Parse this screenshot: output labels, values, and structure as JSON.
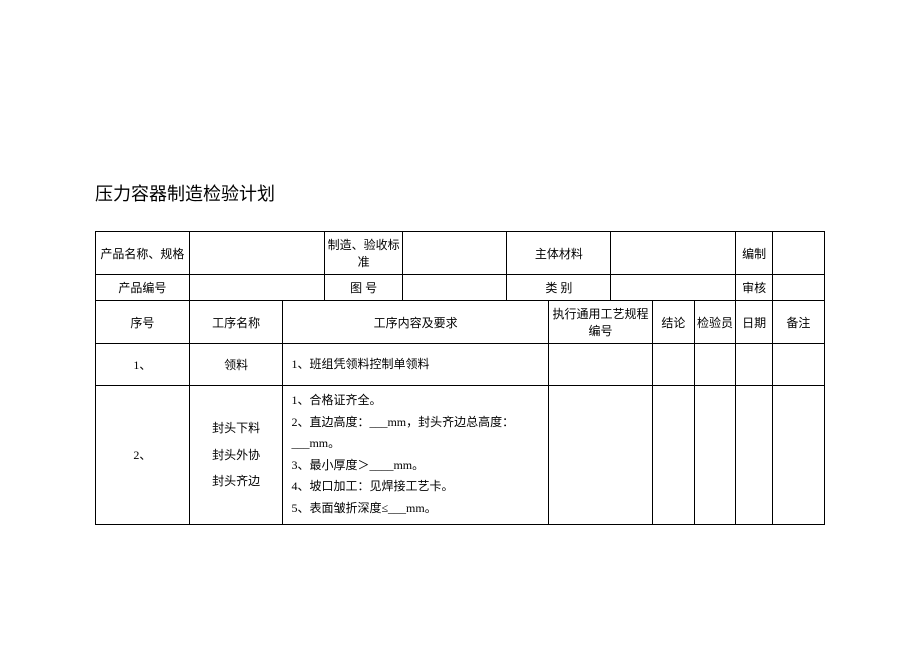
{
  "title": "压力容器制造检验计划",
  "header_labels": {
    "product_name_spec": "产品名称、规格",
    "mfg_accept_std": "制造、验收标准",
    "main_material": "主体材料",
    "prepared_by": "编制",
    "product_no": "产品编号",
    "drawing_no": "图 号",
    "category": "类 别",
    "reviewed_by": "审核"
  },
  "col_headers": {
    "seq": "序号",
    "process_name": "工序名称",
    "process_content": "工序内容及要求",
    "general_proc_no": "执行通用工艺规程编号",
    "conclusion": "结论",
    "inspector": "检验员",
    "date": "日期",
    "remark": "备注"
  },
  "rows": [
    {
      "seq": "1、",
      "process_name": "领料",
      "content": "1、班组凭领料控制单领料"
    },
    {
      "seq": "2、",
      "process_name": "封头下料\n封头外协\n封头齐边",
      "content": "1、合格证齐全。\n2、直边高度：___mm，封头齐边总高度：___mm。\n3、最小厚度＞____mm。\n4、坡口加工：见焊接工艺卡。\n5、表面皱折深度≤___mm。"
    }
  ]
}
